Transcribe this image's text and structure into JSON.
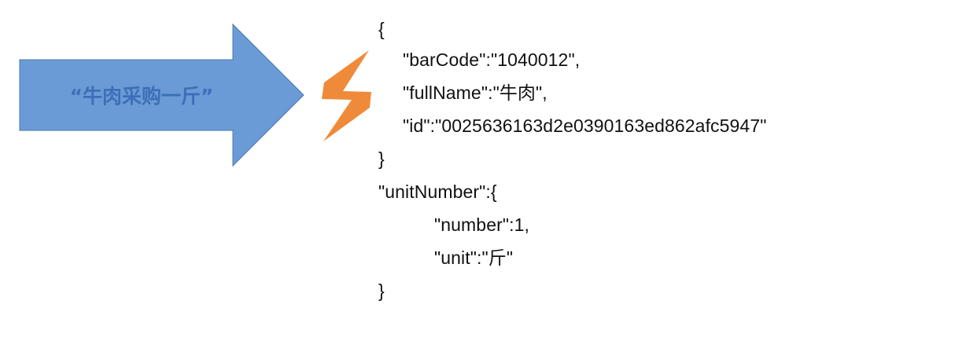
{
  "colors": {
    "arrow_fill": "#6B9BD6",
    "arrow_stroke": "#4E79AE",
    "arrow_text": "#3C6FB7",
    "lightning_fill": "#EF8A3A",
    "code_text": "#111111"
  },
  "arrow": {
    "label": "“牛肉采购一斤”"
  },
  "lightning": {
    "icon": "lightning-bolt-icon"
  },
  "code": {
    "lines": [
      "{",
      "\"barCode\":\"1040012\",",
      "\"fullName\":\"牛肉\",",
      "\"id\":\"0025636163d2e0390163ed862afc5947\"",
      "}",
      "\"unitNumber\":{",
      "\"number\":1,",
      "\"unit\":\"斤\"",
      "}"
    ]
  }
}
